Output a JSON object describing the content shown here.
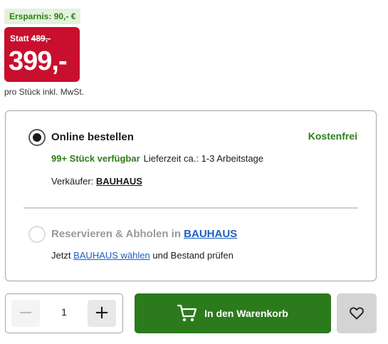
{
  "pricing": {
    "savings": "Ersparnis: 90,- €",
    "was_prefix": "Statt",
    "was_price": "489,-",
    "current_price": "399,-",
    "unit_note": "pro Stück inkl. MwSt.",
    "badge_color": "#c8102e"
  },
  "delivery": {
    "online": {
      "title": "Online bestellen",
      "selected": true,
      "shipping_cost": "Kostenfrei",
      "stock": "99+ Stück verfügbar",
      "lead_time": "Lieferzeit ca.: 1-3 Arbeitstage",
      "seller_label": "Verkäufer:",
      "seller_name": "BAUHAUS"
    },
    "pickup": {
      "title_prefix": "Reservieren & Abholen in",
      "store_link": "BAUHAUS",
      "selected": false,
      "hint_prefix": "Jetzt",
      "hint_link": "BAUHAUS wählen",
      "hint_suffix": "und Bestand prüfen"
    }
  },
  "purchase": {
    "quantity": "1",
    "decrement": "−",
    "increment": "+",
    "add_to_cart": "In den Warenkorb",
    "cart_icon": "shopping-cart-icon",
    "wishlist_icon": "heart-icon",
    "accent_color": "#2b7a1c"
  }
}
